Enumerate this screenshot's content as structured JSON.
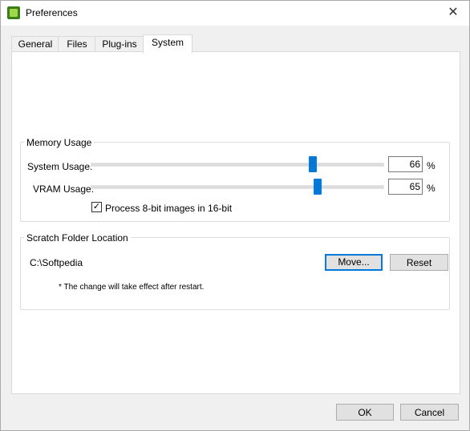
{
  "window": {
    "title": "Preferences",
    "close_glyph": "✕"
  },
  "tabs": [
    {
      "label": "General"
    },
    {
      "label": "Files"
    },
    {
      "label": "Plug-ins"
    },
    {
      "label": "System",
      "active": true
    }
  ],
  "memory": {
    "group_label": "Memory Usage",
    "system": {
      "label": "System Usage:",
      "value": "66",
      "unit": "%"
    },
    "vram": {
      "label": "VRAM Usage:",
      "value": "65",
      "unit": "%"
    },
    "checkbox": {
      "label": "Process 8-bit images in 16-bit",
      "checked": true,
      "mark": "✓"
    }
  },
  "scratch": {
    "group_label": "Scratch Folder Location",
    "path": "C:\\Softpedia",
    "move_label": "Move...",
    "reset_label": "Reset",
    "note": "* The change will take effect after restart."
  },
  "footer": {
    "ok_label": "OK",
    "cancel_label": "Cancel"
  },
  "colors": {
    "accent": "#0078d7",
    "window_bg": "#f0f0f0",
    "panel_bg": "#ffffff"
  }
}
